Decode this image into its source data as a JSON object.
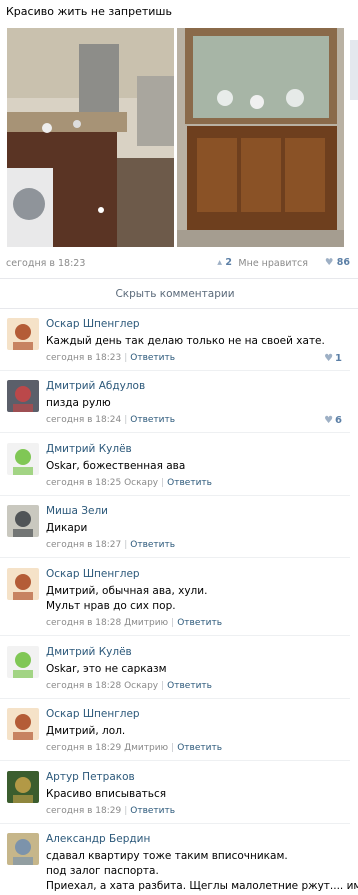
{
  "post": {
    "text": "Красиво жить не запретишь",
    "date": "сегодня в 18:23",
    "reposts": "2",
    "like_label": "Мне нравится",
    "likes": "86"
  },
  "hide_comments": "Скрыть комментарии",
  "comments": [
    {
      "author": "Оскар Шпенглер",
      "lines": [
        "Каждый день так делаю только не на своей хате."
      ],
      "date": "сегодня в 18:23",
      "reply_to": "",
      "reply_label": "Ответить",
      "likes": "1"
    },
    {
      "author": "Дмитрий Абдулов",
      "lines": [
        "пизда рулю"
      ],
      "date": "сегодня в 18:24",
      "reply_to": "",
      "reply_label": "Ответить",
      "likes": "6"
    },
    {
      "author": "Дмитрий Кулёв",
      "lines": [
        "Oskar, божественная ава"
      ],
      "date": "сегодня в 18:25",
      "reply_to": "Оскару",
      "reply_label": "Ответить",
      "likes": ""
    },
    {
      "author": "Миша Зели",
      "lines": [
        "Дикари"
      ],
      "date": "сегодня в 18:27",
      "reply_to": "",
      "reply_label": "Ответить",
      "likes": ""
    },
    {
      "author": "Оскар Шпенглер",
      "lines": [
        "Дмитрий, обычная ава, хули.",
        "Мульт нрав до сих пор."
      ],
      "date": "сегодня в 18:28",
      "reply_to": "Дмитрию",
      "reply_label": "Ответить",
      "likes": ""
    },
    {
      "author": "Дмитрий Кулёв",
      "lines": [
        "Oskar, это не сарказм"
      ],
      "date": "сегодня в 18:28",
      "reply_to": "Оскару",
      "reply_label": "Ответить",
      "likes": ""
    },
    {
      "author": "Оскар Шпенглер",
      "lines": [
        "Дмитрий, лол."
      ],
      "date": "сегодня в 18:29",
      "reply_to": "Дмитрию",
      "reply_label": "Ответить",
      "likes": ""
    },
    {
      "author": "Артур Петраков",
      "lines": [
        "Красиво вписываться"
      ],
      "date": "сегодня в 18:29",
      "reply_to": "",
      "reply_label": "Ответить",
      "likes": ""
    },
    {
      "author": "Александр Бердин",
      "lines": [
        "сдавал квартиру тоже таким вписочникам.",
        "под залог паспорта.",
        "Приехал, а хата разбита. Щеглы малолетние ржут.... им"
      ],
      "date": "",
      "reply_to": "",
      "reply_label": "",
      "likes": ""
    }
  ],
  "colors": {
    "link": "#2b587a",
    "meta": "#8a8a8a",
    "like": "#5b7fa6"
  },
  "icons": {
    "repost": "megaphone-icon",
    "like": "heart-icon"
  }
}
